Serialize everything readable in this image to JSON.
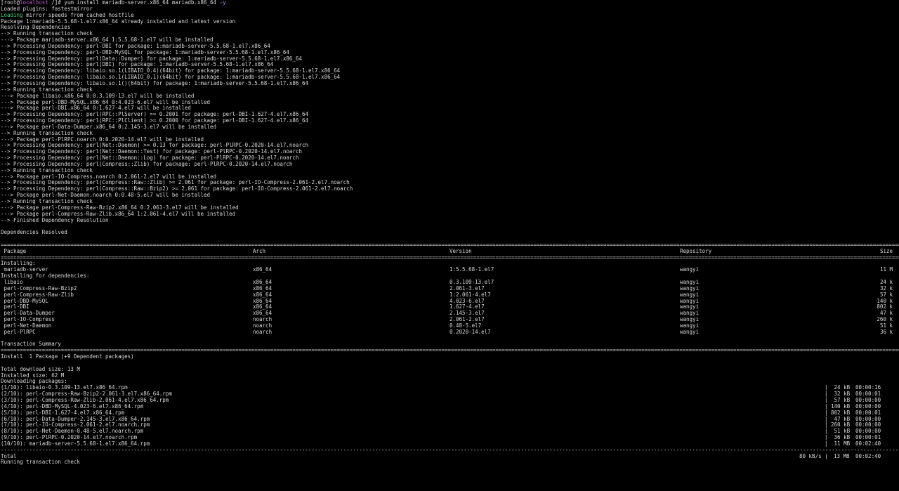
{
  "prompt": {
    "open": "[root@",
    "host": "localhost",
    "rest": " /]# yum install mariadb-server.x86_64 mariadb.x86_64 ",
    "flag": "-y"
  },
  "pre_lines": [
    "Loaded plugins: fastestmirror"
  ],
  "loading": {
    "word": "Loading",
    "rest": " mirror speeds from cached hostfile"
  },
  "log_lines": [
    "Package 1:mariadb-5.5.68-1.el7.x86_64 already installed and latest version",
    "Resolving Dependencies",
    "--> Running transaction check",
    "---> Package mariadb-server.x86_64 1:5.5.68-1.el7 will be installed",
    "--> Processing Dependency: perl-DBI for package: 1:mariadb-server-5.5.68-1.el7.x86_64",
    "--> Processing Dependency: perl-DBD-MySQL for package: 1:mariadb-server-5.5.68-1.el7.x86_64",
    "--> Processing Dependency: perl(Data::Dumper) for package: 1:mariadb-server-5.5.68-1.el7.x86_64",
    "--> Processing Dependency: perl(DBI) for package: 1:mariadb-server-5.5.68-1.el7.x86_64",
    "--> Processing Dependency: libaio.so.1(LIBAIO_0.4)(64bit) for package: 1:mariadb-server-5.5.68-1.el7.x86_64",
    "--> Processing Dependency: libaio.so.1(LIBAIO_0.1)(64bit) for package: 1:mariadb-server-5.5.68-1.el7.x86_64",
    "--> Processing Dependency: libaio.so.1()(64bit) for package: 1:mariadb-server-5.5.68-1.el7.x86_64",
    "--> Running transaction check",
    "---> Package libaio.x86_64 0:0.3.109-13.el7 will be installed",
    "---> Package perl-DBD-MySQL.x86_64 0:4.023-6.el7 will be installed",
    "---> Package perl-DBI.x86_64 0:1.627-4.el7 will be installed",
    "--> Processing Dependency: perl(RPC::PlServer) >= 0.2001 for package: perl-DBI-1.627-4.el7.x86_64",
    "--> Processing Dependency: perl(RPC::PlClient) >= 0.2000 for package: perl-DBI-1.627-4.el7.x86_64",
    "---> Package perl-Data-Dumper.x86_64 0:2.145-3.el7 will be installed",
    "--> Running transaction check",
    "---> Package perl-PlRPC.noarch 0:0.2020-14.el7 will be installed",
    "--> Processing Dependency: perl(Net::Daemon) >= 0.13 for package: perl-PlRPC-0.2020-14.el7.noarch",
    "--> Processing Dependency: perl(Net::Daemon::Test) for package: perl-PlRPC-0.2020-14.el7.noarch",
    "--> Processing Dependency: perl(Net::Daemon::Log) for package: perl-PlRPC-0.2020-14.el7.noarch",
    "--> Processing Dependency: perl(Compress::Zlib) for package: perl-PlRPC-0.2020-14.el7.noarch",
    "--> Running transaction check",
    "---> Package perl-IO-Compress.noarch 0:2.061-2.el7 will be installed",
    "--> Processing Dependency: perl(Compress::Raw::Zlib) >= 2.061 for package: perl-IO-Compress-2.061-2.el7.noarch",
    "--> Processing Dependency: perl(Compress::Raw::Bzip2) >= 2.061 for package: perl-IO-Compress-2.061-2.el7.noarch",
    "---> Package perl-Net-Daemon.noarch 0:0.48-5.el7 will be installed",
    "--> Running transaction check",
    "---> Package perl-Compress-Raw-Bzip2.x86_64 0:2.061-3.el7 will be installed",
    "---> Package perl-Compress-Raw-Zlib.x86_64 1:2.061-4.el7 will be installed",
    "--> Finished Dependency Resolution",
    "",
    "Dependencies Resolved",
    ""
  ],
  "table": {
    "headers": {
      "package": " Package",
      "arch": "Arch",
      "version": "Version",
      "repository": "Repository",
      "size": "Size"
    },
    "installing_label": "Installing:",
    "installing": [
      {
        "package": " mariadb-server",
        "arch": "x86_64",
        "version": "1:5.5.68-1.el7",
        "repository": "wangyi",
        "size": "11 M"
      }
    ],
    "deps_label": "Installing for dependencies:",
    "deps": [
      {
        "package": " libaio",
        "arch": "x86_64",
        "version": "0.3.109-13.el7",
        "repository": "wangyi",
        "size": "24 k"
      },
      {
        "package": " perl-Compress-Raw-Bzip2",
        "arch": "x86_64",
        "version": "2.061-3.el7",
        "repository": "wangyi",
        "size": "32 k"
      },
      {
        "package": " perl-Compress-Raw-Zlib",
        "arch": "x86_64",
        "version": "1:2.061-4.el7",
        "repository": "wangyi",
        "size": "57 k"
      },
      {
        "package": " perl-DBD-MySQL",
        "arch": "x86_64",
        "version": "4.023-6.el7",
        "repository": "wangyi",
        "size": "140 k"
      },
      {
        "package": " perl-DBI",
        "arch": "x86_64",
        "version": "1.627-4.el7",
        "repository": "wangyi",
        "size": "802 k"
      },
      {
        "package": " perl-Data-Dumper",
        "arch": "x86_64",
        "version": "2.145-3.el7",
        "repository": "wangyi",
        "size": "47 k"
      },
      {
        "package": " perl-IO-Compress",
        "arch": "noarch",
        "version": "2.061-2.el7",
        "repository": "wangyi",
        "size": "260 k"
      },
      {
        "package": " perl-Net-Daemon",
        "arch": "noarch",
        "version": "0.48-5.el7",
        "repository": "wangyi",
        "size": "51 k"
      },
      {
        "package": " perl-PlRPC",
        "arch": "noarch",
        "version": "0.2020-14.el7",
        "repository": "wangyi",
        "size": "36 k"
      }
    ]
  },
  "summary": {
    "title": "Transaction Summary",
    "install_line": "Install  1 Package (+9 Dependent packages)",
    "download_size": "Total download size: 13 M",
    "installed_size": "Installed size: 62 M",
    "downloading": "Downloading packages:"
  },
  "downloads": [
    {
      "name": "(1/10): libaio-0.3.109-13.el7.x86_64.rpm",
      "size": "|  24 kB",
      "time": "00:00:16"
    },
    {
      "name": "(2/10): perl-Compress-Raw-Bzip2-2.061-3.el7.x86_64.rpm",
      "size": "|  32 kB",
      "time": "00:00:01"
    },
    {
      "name": "(3/10): perl-Compress-Raw-Zlib-2.061-4.el7.x86_64.rpm",
      "size": "|  57 kB",
      "time": "00:00:00"
    },
    {
      "name": "(4/10): perl-DBD-MySQL-4.023-6.el7.x86_64.rpm",
      "size": "| 140 kB",
      "time": "00:00:00"
    },
    {
      "name": "(5/10): perl-DBI-1.627-4.el7.x86_64.rpm",
      "size": "| 802 kB",
      "time": "00:00:01"
    },
    {
      "name": "(6/10): perl-Data-Dumper-2.145-3.el7.x86_64.rpm",
      "size": "|  47 kB",
      "time": "00:00:00"
    },
    {
      "name": "(7/10): perl-IO-Compress-2.061-2.el7.noarch.rpm",
      "size": "| 260 kB",
      "time": "00:00:00"
    },
    {
      "name": "(8/10): perl-Net-Daemon-0.48-5.el7.noarch.rpm",
      "size": "|  51 kB",
      "time": "00:00:00"
    },
    {
      "name": "(9/10): perl-PlRPC-0.2020-14.el7.noarch.rpm",
      "size": "|  36 kB",
      "time": "00:00:01"
    },
    {
      "name": "(10/10): mariadb-server-5.5.68-1.el7.x86_64.rpm",
      "size": "|  11 MB",
      "time": "00:02:40"
    }
  ],
  "total": {
    "label": "Total",
    "rate": "80 kB/s |",
    "size": "13 MB",
    "time": "00:02:40"
  },
  "final_line": "Running transaction check",
  "colors": {
    "background": "#000000",
    "text": "#d9d9d9",
    "host": "#c45fd6",
    "flag": "#8aa6ff",
    "loading": "#3fd07a"
  }
}
